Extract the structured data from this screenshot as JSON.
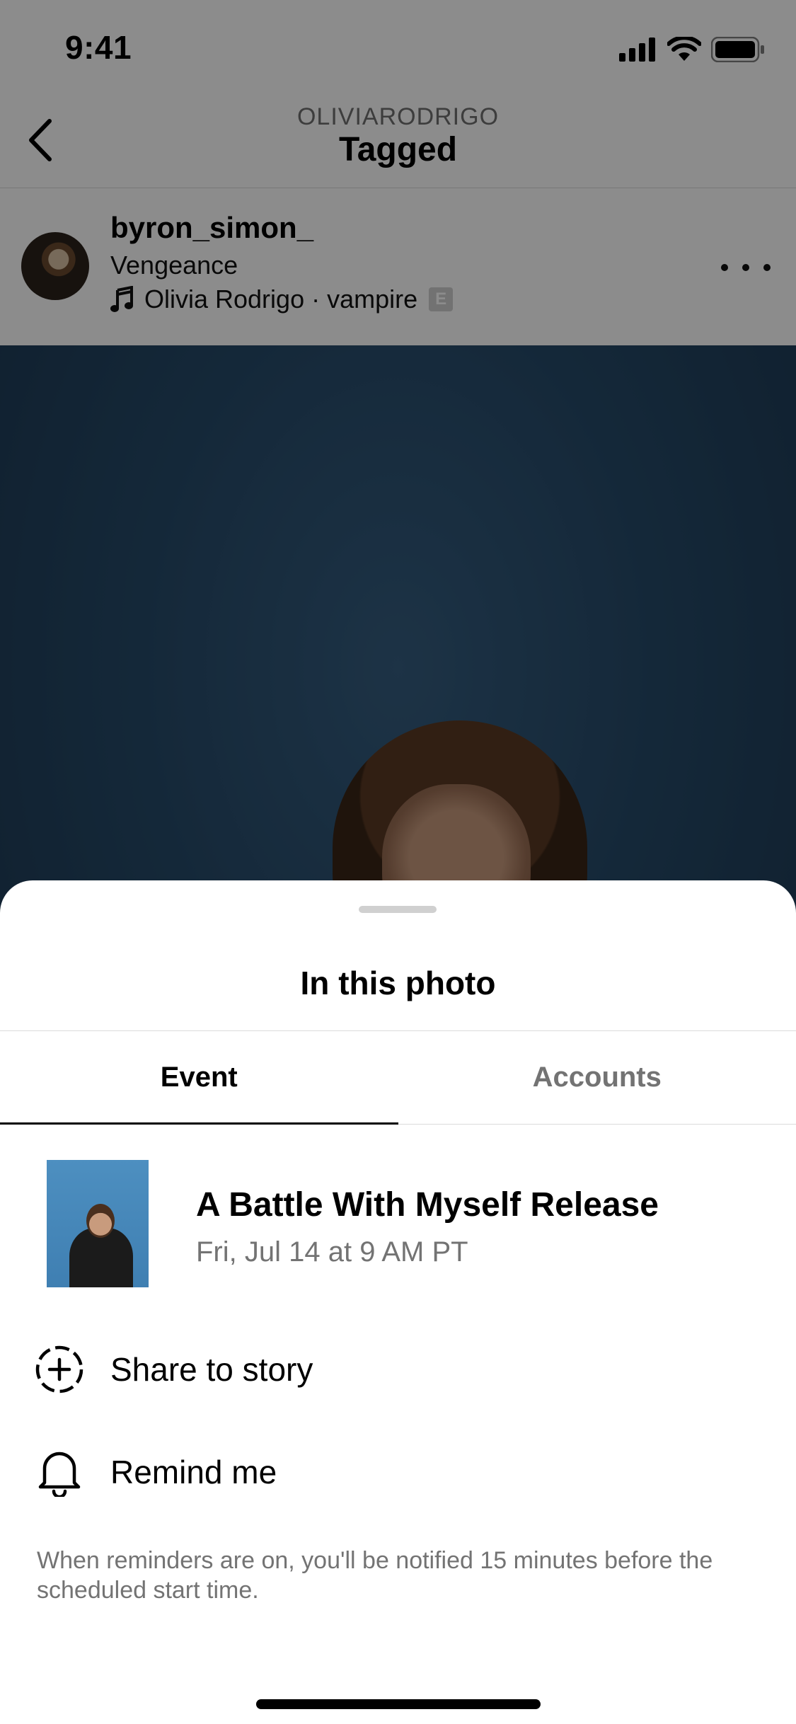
{
  "status_bar": {
    "time": "9:41"
  },
  "nav": {
    "subtitle": "OLIVIARODRIGO",
    "title": "Tagged"
  },
  "post": {
    "username": "byron_simon_",
    "subtitle": "Vengeance",
    "audio": "Olivia Rodrigo · vampire",
    "explicit_badge": "E"
  },
  "sheet": {
    "title": "In this photo",
    "tabs": [
      {
        "label": "Event",
        "active": true
      },
      {
        "label": "Accounts",
        "active": false
      }
    ],
    "event": {
      "title": "A Battle With Myself Release",
      "time": "Fri, Jul 14 at 9 AM PT"
    },
    "actions": [
      {
        "label": "Share to story",
        "icon": "dashed-circle-plus-icon"
      },
      {
        "label": "Remind me",
        "icon": "bell-icon"
      }
    ],
    "note": "When reminders are on, you'll be notified 15 minutes before the scheduled start time."
  }
}
